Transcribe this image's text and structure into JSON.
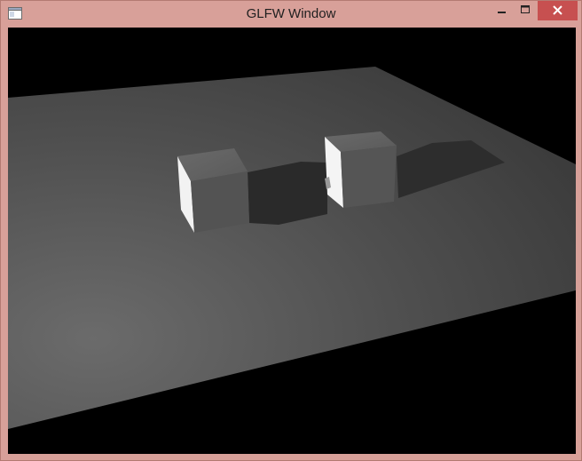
{
  "window": {
    "title": "GLFW Window",
    "app_icon": "application-icon",
    "controls": {
      "minimize_icon": "minimize-icon",
      "maximize_icon": "maximize-icon",
      "close_icon": "close-icon",
      "close_color": "#c75050"
    },
    "frame_color": "#d8a099"
  },
  "scene": {
    "background_color": "#000000",
    "floor_color": "#4a4a4a",
    "cube_color": "#5a5a5a"
  }
}
